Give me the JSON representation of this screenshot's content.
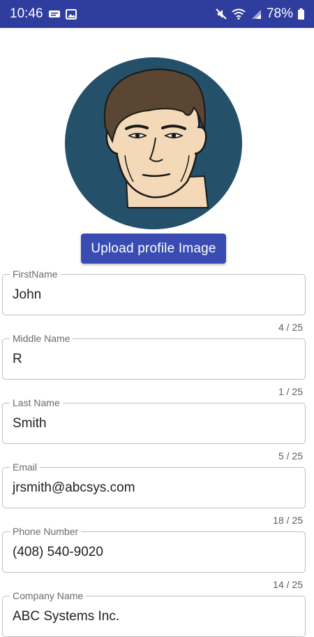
{
  "status_bar": {
    "time": "10:46",
    "battery": "78%",
    "icons": [
      "notification-icon",
      "image-icon",
      "mute-icon",
      "wifi-icon",
      "signal-icon",
      "battery-icon"
    ]
  },
  "colors": {
    "status_bar": "#2f3d9f",
    "button": "#3a4cb1",
    "avatar_bg": "#24506a"
  },
  "profile": {
    "upload_label": "Upload profile Image"
  },
  "fields": [
    {
      "label": "FirstName",
      "value": "John",
      "counter": "4 / 25"
    },
    {
      "label": "Middle Name",
      "value": "R",
      "counter": "1 / 25"
    },
    {
      "label": "Last Name",
      "value": "Smith",
      "counter": "5 / 25"
    },
    {
      "label": "Email",
      "value": "jrsmith@abcsys.com",
      "counter": "18 / 25"
    },
    {
      "label": "Phone Number",
      "value": "(408) 540-9020",
      "counter": "14 / 25"
    },
    {
      "label": "Company Name",
      "value": "ABC Systems Inc."
    }
  ]
}
